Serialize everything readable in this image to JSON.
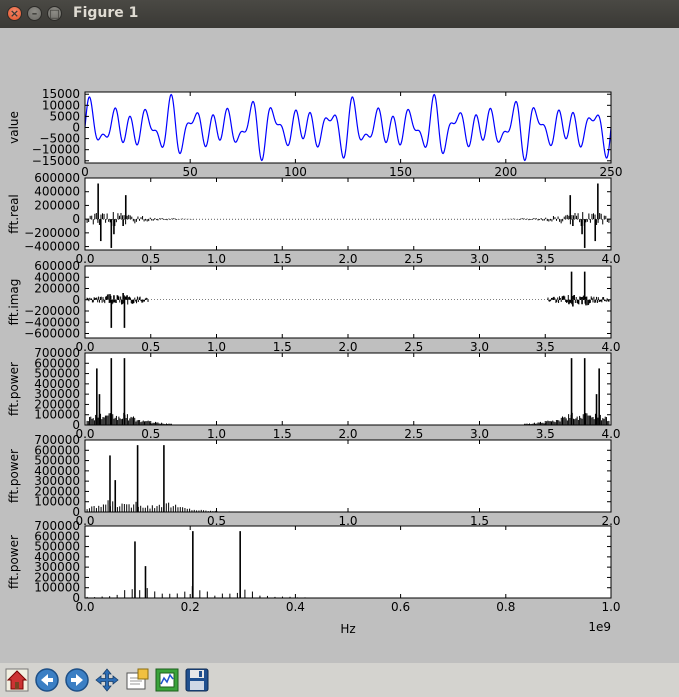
{
  "window": {
    "title": "Figure 1"
  },
  "toolbar": {
    "buttons": [
      {
        "name": "home-button",
        "icon": "home-icon"
      },
      {
        "name": "back-button",
        "icon": "arrow-left-icon"
      },
      {
        "name": "forward-button",
        "icon": "arrow-right-icon"
      },
      {
        "name": "pan-button",
        "icon": "move-icon"
      },
      {
        "name": "zoom-button",
        "icon": "zoom-rect-icon"
      },
      {
        "name": "subplots-button",
        "icon": "subplots-icon"
      },
      {
        "name": "save-button",
        "icon": "floppy-disk-icon"
      }
    ]
  },
  "chart_data": [
    {
      "type": "line",
      "ylabel": "value",
      "xlim": [
        0,
        256
      ],
      "ylim": [
        -16000,
        16000
      ],
      "xticks": [
        "0",
        "50",
        "100",
        "150",
        "200",
        "250"
      ],
      "yticks": [
        "15000",
        "10000",
        "5000",
        "0",
        "−5000",
        "−10000",
        "−15000"
      ],
      "color": "#0000ff",
      "components": [
        {
          "amp": 5000,
          "cycles": 20
        },
        {
          "amp": 5000,
          "cycles": 26
        },
        {
          "amp": 5000,
          "cycles": 38
        }
      ]
    },
    {
      "type": "bar",
      "ylabel": "fft.real",
      "xlim": [
        0,
        4.0
      ],
      "ylim": [
        -450000,
        600000
      ],
      "xticks": [
        "0.0",
        "0.5",
        "1.0",
        "1.5",
        "2.0",
        "2.5",
        "3.0",
        "3.5",
        "4.0"
      ],
      "yticks": [
        "600000",
        "400000",
        "200000",
        "0",
        "−200000",
        "−400000"
      ],
      "peaks": [
        {
          "x": 0.1,
          "y": 520000
        },
        {
          "x": 0.12,
          "y": -320000
        },
        {
          "x": 0.2,
          "y": -420000
        },
        {
          "x": 0.22,
          "y": -220000
        },
        {
          "x": 0.29,
          "y": -100000
        },
        {
          "x": 0.31,
          "y": 350000
        }
      ],
      "extent": 0.82
    },
    {
      "type": "bar",
      "ylabel": "fft.imag",
      "xlim": [
        0,
        4.0
      ],
      "ylim": [
        -680000,
        600000
      ],
      "xticks": [
        "0.0",
        "0.5",
        "1.0",
        "1.5",
        "2.0",
        "2.5",
        "3.0",
        "3.5",
        "4.0"
      ],
      "yticks": [
        "600000",
        "400000",
        "200000",
        "0",
        "−200000",
        "−400000",
        "−600000"
      ],
      "peaks": [
        {
          "x": 0.19,
          "y": 100000
        },
        {
          "x": 0.2,
          "y": -500000
        },
        {
          "x": 0.22,
          "y": 80000
        },
        {
          "x": 0.29,
          "y": 120000
        },
        {
          "x": 0.3,
          "y": -500000
        },
        {
          "x": 0.32,
          "y": 80000
        }
      ],
      "extent": 0.47
    },
    {
      "type": "bar",
      "ylabel": "fft.power",
      "xlim": [
        0,
        4.0
      ],
      "ylim": [
        0,
        700000
      ],
      "xticks": [
        "0.0",
        "0.5",
        "1.0",
        "1.5",
        "2.0",
        "2.5",
        "3.0",
        "3.5",
        "4.0"
      ],
      "yticks": [
        "700000",
        "600000",
        "500000",
        "400000",
        "300000",
        "200000",
        "100000",
        "0"
      ],
      "peaks": [
        {
          "x": 0.09,
          "y": 550000
        },
        {
          "x": 0.11,
          "y": 300000
        },
        {
          "x": 0.2,
          "y": 650000
        },
        {
          "x": 0.3,
          "y": 650000
        }
      ],
      "extent": 0.65
    },
    {
      "type": "bar",
      "ylabel": "fft.power",
      "xlim": [
        0,
        2.0
      ],
      "ylim": [
        0,
        700000
      ],
      "xticks": [
        "0.0",
        "0.5",
        "1.0",
        "1.5",
        "2.0"
      ],
      "yticks": [
        "700000",
        "600000",
        "500000",
        "400000",
        "300000",
        "200000",
        "100000",
        "0"
      ],
      "peaks": [
        {
          "x": 0.095,
          "y": 550000
        },
        {
          "x": 0.115,
          "y": 310000
        },
        {
          "x": 0.2,
          "y": 650000
        },
        {
          "x": 0.3,
          "y": 650000
        }
      ],
      "extent": 0.62
    },
    {
      "type": "bar",
      "ylabel": "fft.power",
      "xlabel": "Hz",
      "x_multiplier": "1e9",
      "xlim": [
        0,
        1.0
      ],
      "ylim": [
        0,
        700000
      ],
      "xticks": [
        "0.0",
        "0.2",
        "0.4",
        "0.6",
        "0.8",
        "1.0"
      ],
      "yticks": [
        "700000",
        "600000",
        "500000",
        "400000",
        "300000",
        "200000",
        "100000",
        "0"
      ],
      "peaks": [
        {
          "x": 0.095,
          "y": 550000
        },
        {
          "x": 0.115,
          "y": 310000
        },
        {
          "x": 0.205,
          "y": 650000
        },
        {
          "x": 0.295,
          "y": 650000
        }
      ],
      "extent": 1.0
    }
  ]
}
